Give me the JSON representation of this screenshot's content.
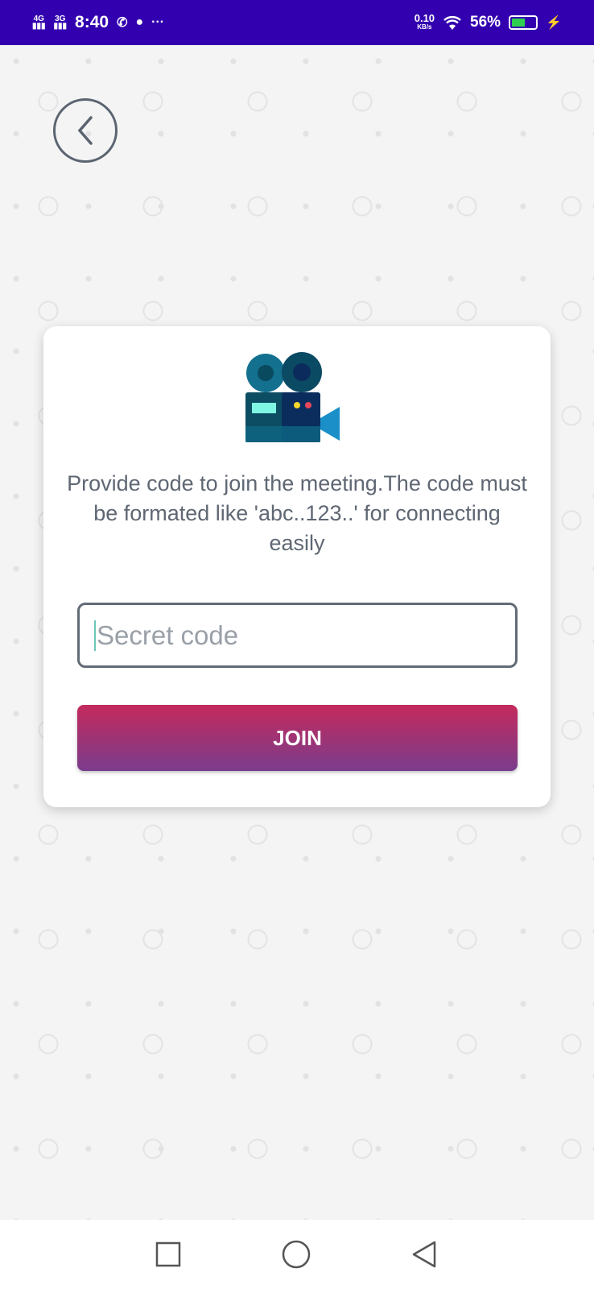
{
  "status_bar": {
    "network1": "4G",
    "network2": "3G",
    "time": "8:40",
    "speed": "0.10",
    "speed_unit": "KB/s",
    "battery": "56%",
    "battery_level": 0.56,
    "icons": [
      "whatsapp-icon",
      "messenger-icon",
      "more-icon",
      "wifi-icon",
      "battery-icon",
      "charging-icon"
    ]
  },
  "main": {
    "description": "Provide code to join the meeting.The code must be formated like 'abc..123..' for connecting easily",
    "code_input": {
      "value": "",
      "placeholder": "Secret code"
    },
    "join_label": "JOIN"
  },
  "colors": {
    "status_bar": "#3300b0",
    "join_top": "#c42a5c",
    "join_bottom": "#7a3c8c",
    "text": "#5f6773"
  }
}
